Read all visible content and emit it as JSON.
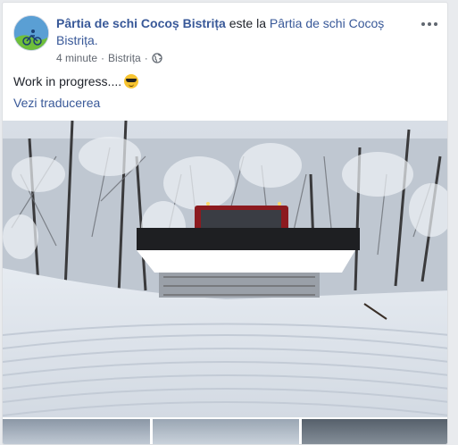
{
  "post": {
    "author": "Pârtia de schi Cocoș Bistrița",
    "connector": " este la ",
    "location_page": "Pârtia de schi Cocoș Bistrița.",
    "time": "4 minute",
    "separator": "·",
    "place": "Bistrița",
    "privacy_icon": "globe-icon",
    "text": "Work in progress....",
    "emoji": "smiling-face-with-sunglasses",
    "translate_link": "Vezi traducerea"
  },
  "colors": {
    "link": "#385898",
    "secondary": "#616770",
    "background": "#e9ebee"
  },
  "media": {
    "main_photo": "snow-groomer-on-ski-slope",
    "thumbnail_count": 3
  }
}
